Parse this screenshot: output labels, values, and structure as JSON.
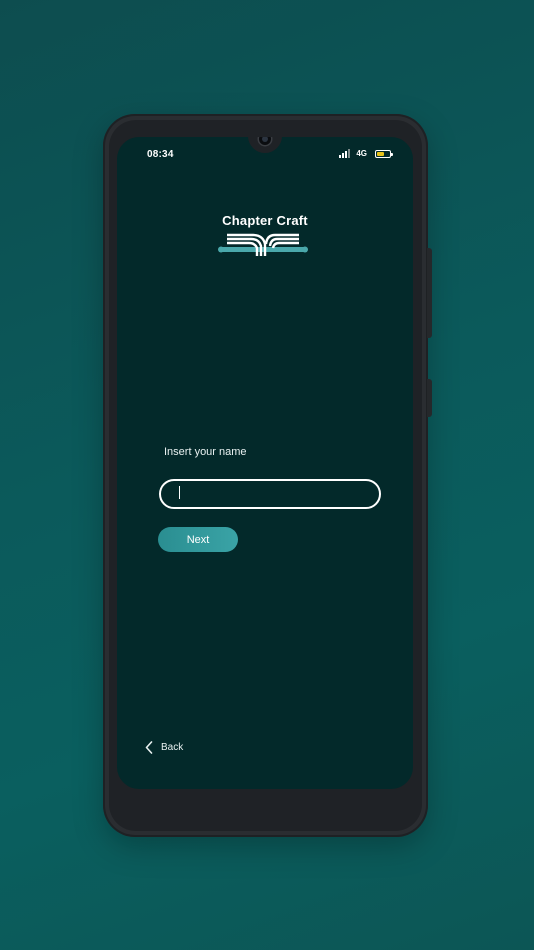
{
  "status_bar": {
    "time": "08:34",
    "network": "4G",
    "battery_level": 0.6,
    "signal_bars": 4,
    "signal_bars_active": 3
  },
  "app": {
    "title": "Chapter Craft",
    "logo_icon": "open-book-logo-icon"
  },
  "form": {
    "name_label": "Insert your name",
    "name_value": "",
    "name_placeholder": "",
    "next_label": "Next"
  },
  "navigation": {
    "back_label": "Back",
    "back_icon": "chevron-left-icon"
  },
  "colors": {
    "screen_background": "#03292a",
    "accent": "#3aa3a6",
    "battery": "#e8c31a",
    "page_background": "#0b5a5b"
  }
}
